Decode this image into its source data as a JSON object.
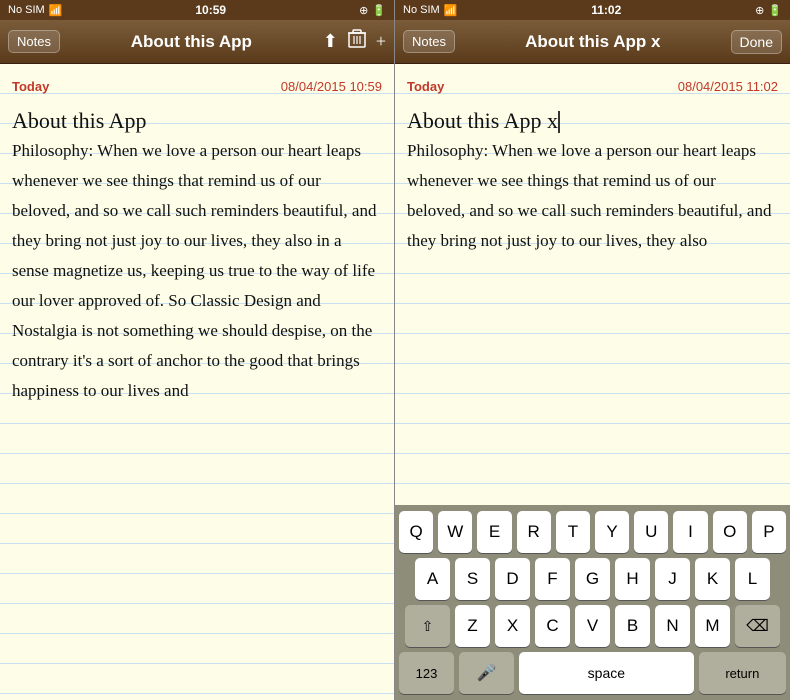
{
  "panel_left": {
    "status": {
      "carrier": "No SIM",
      "wifi": "▾",
      "time": "10:59",
      "icons_right": "🔵 ✦ 🔋"
    },
    "nav": {
      "back_label": "Notes",
      "title": "About this App",
      "share_icon": "⬆",
      "trash_icon": "🗑",
      "add_icon": "+"
    },
    "note": {
      "date_label": "Today",
      "date_value": "08/04/2015 10:59",
      "title": "About this App",
      "body": "Philosophy: When we love a person our heart leaps whenever we see things that remind us of our beloved, and so we call such reminders beautiful, and they bring not just joy to our lives, they also in a sense magnetize us, keeping us true to the way of life our lover approved of. So Classic Design and Nostalgia is not something we should despise, on the contrary it's a sort of anchor to the good that brings happiness to our lives and"
    }
  },
  "panel_right": {
    "status": {
      "carrier": "No SIM",
      "wifi": "▾",
      "time": "11:02",
      "icons_right": "🔵 ✦ 🔋"
    },
    "nav": {
      "back_label": "Notes",
      "title": "About this App x",
      "done_label": "Done"
    },
    "note": {
      "date_label": "Today",
      "date_value": "08/04/2015 11:02",
      "title": "About this App x",
      "body": "Philosophy: When we love a person our heart leaps whenever we see things that remind us of our beloved, and so we call such reminders beautiful, and they bring not just joy to our lives, they also"
    },
    "keyboard": {
      "rows": [
        [
          "Q",
          "W",
          "E",
          "R",
          "T",
          "Y",
          "U",
          "I",
          "O",
          "P"
        ],
        [
          "A",
          "S",
          "D",
          "F",
          "G",
          "H",
          "J",
          "K",
          "L"
        ],
        [
          "Z",
          "X",
          "C",
          "V",
          "B",
          "N",
          "M"
        ]
      ],
      "bottom": {
        "numbers": "123",
        "mic": "🎤",
        "space": "space",
        "return": "return",
        "backspace": "⌫",
        "shift": "⇧"
      }
    }
  }
}
